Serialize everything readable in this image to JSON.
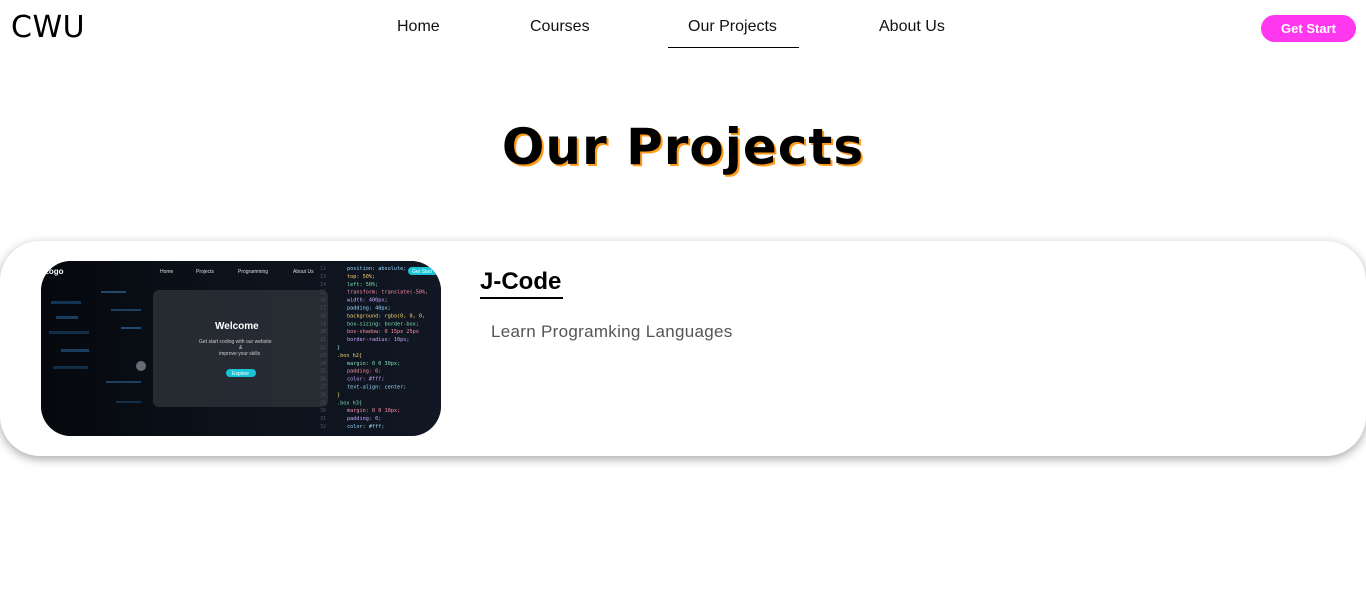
{
  "brand": {
    "logo_text": "CWU"
  },
  "nav": {
    "items": [
      {
        "label": "Home"
      },
      {
        "label": "Courses"
      },
      {
        "label": "Our Projects"
      },
      {
        "label": "About Us"
      }
    ],
    "active": "Our Projects",
    "cta_label": "Get Start"
  },
  "page": {
    "title": "Our Projects"
  },
  "project": {
    "title": "J-Code",
    "description": "Learn Programking Languages",
    "thumbnail": {
      "logo": "Logo",
      "nav": [
        "Home",
        "Projects",
        "Programming",
        "About Us"
      ],
      "cta": "Get Start",
      "heading": "Welcome",
      "line1": "Get start coding with our website",
      "line2": "&",
      "line3": "improve your skills",
      "button": "Explore",
      "code": [
        "position: absolute;",
        "top: 50%;",
        "left: 50%;",
        "transform: translate(-50%,",
        "width: 400px;",
        "padding: 40px;",
        "background: rgba(0, 0, 0,",
        "box-sizing: border-box;",
        "box-shadow: 0 15px 25px",
        "border-radius: 10px;",
        "}",
        ".box h2{",
        "margin: 0 0 30px;",
        "padding: 0;",
        "color: #fff;",
        "text-align: center;",
        "}",
        ".box h3{",
        "margin: 0 0 10px;",
        "padding: 0;",
        "color: #fff;"
      ]
    }
  },
  "colors": {
    "accent": "#ff38f0",
    "title_shadow": "#ff9a1a"
  }
}
